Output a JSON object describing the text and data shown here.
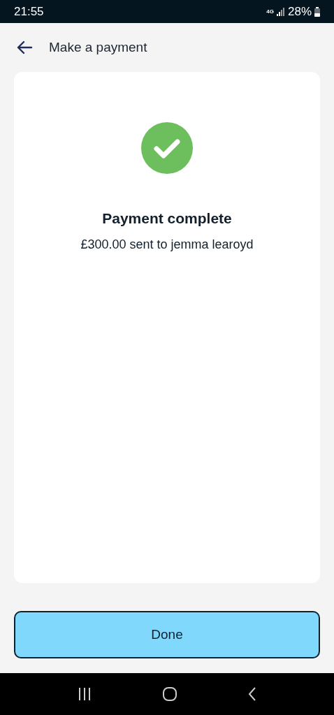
{
  "status_bar": {
    "time": "21:55",
    "network": "4G",
    "battery": "28%"
  },
  "header": {
    "title": "Make a payment"
  },
  "result": {
    "title": "Payment complete",
    "message": "£300.00 sent to jemma learoyd"
  },
  "done_button": {
    "label": "Done"
  }
}
